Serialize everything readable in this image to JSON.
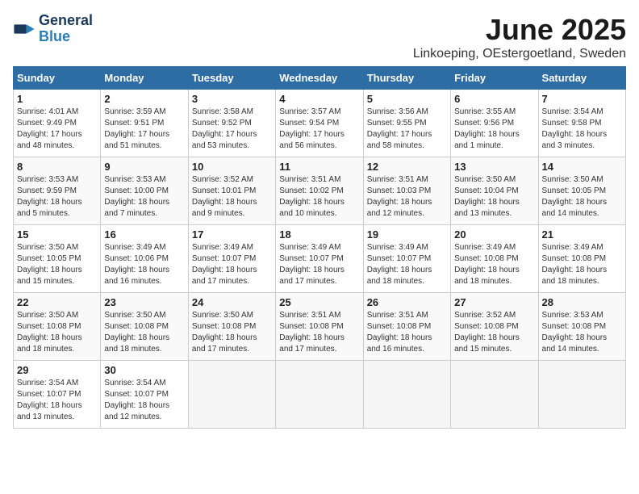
{
  "logo": {
    "line1": "General",
    "line2": "Blue"
  },
  "title": "June 2025",
  "subtitle": "Linkoeping, OEstergoetland, Sweden",
  "days_header": [
    "Sunday",
    "Monday",
    "Tuesday",
    "Wednesday",
    "Thursday",
    "Friday",
    "Saturday"
  ],
  "weeks": [
    [
      {
        "num": "1",
        "info": "Sunrise: 4:01 AM\nSunset: 9:49 PM\nDaylight: 17 hours\nand 48 minutes."
      },
      {
        "num": "2",
        "info": "Sunrise: 3:59 AM\nSunset: 9:51 PM\nDaylight: 17 hours\nand 51 minutes."
      },
      {
        "num": "3",
        "info": "Sunrise: 3:58 AM\nSunset: 9:52 PM\nDaylight: 17 hours\nand 53 minutes."
      },
      {
        "num": "4",
        "info": "Sunrise: 3:57 AM\nSunset: 9:54 PM\nDaylight: 17 hours\nand 56 minutes."
      },
      {
        "num": "5",
        "info": "Sunrise: 3:56 AM\nSunset: 9:55 PM\nDaylight: 17 hours\nand 58 minutes."
      },
      {
        "num": "6",
        "info": "Sunrise: 3:55 AM\nSunset: 9:56 PM\nDaylight: 18 hours\nand 1 minute."
      },
      {
        "num": "7",
        "info": "Sunrise: 3:54 AM\nSunset: 9:58 PM\nDaylight: 18 hours\nand 3 minutes."
      }
    ],
    [
      {
        "num": "8",
        "info": "Sunrise: 3:53 AM\nSunset: 9:59 PM\nDaylight: 18 hours\nand 5 minutes."
      },
      {
        "num": "9",
        "info": "Sunrise: 3:53 AM\nSunset: 10:00 PM\nDaylight: 18 hours\nand 7 minutes."
      },
      {
        "num": "10",
        "info": "Sunrise: 3:52 AM\nSunset: 10:01 PM\nDaylight: 18 hours\nand 9 minutes."
      },
      {
        "num": "11",
        "info": "Sunrise: 3:51 AM\nSunset: 10:02 PM\nDaylight: 18 hours\nand 10 minutes."
      },
      {
        "num": "12",
        "info": "Sunrise: 3:51 AM\nSunset: 10:03 PM\nDaylight: 18 hours\nand 12 minutes."
      },
      {
        "num": "13",
        "info": "Sunrise: 3:50 AM\nSunset: 10:04 PM\nDaylight: 18 hours\nand 13 minutes."
      },
      {
        "num": "14",
        "info": "Sunrise: 3:50 AM\nSunset: 10:05 PM\nDaylight: 18 hours\nand 14 minutes."
      }
    ],
    [
      {
        "num": "15",
        "info": "Sunrise: 3:50 AM\nSunset: 10:05 PM\nDaylight: 18 hours\nand 15 minutes."
      },
      {
        "num": "16",
        "info": "Sunrise: 3:49 AM\nSunset: 10:06 PM\nDaylight: 18 hours\nand 16 minutes."
      },
      {
        "num": "17",
        "info": "Sunrise: 3:49 AM\nSunset: 10:07 PM\nDaylight: 18 hours\nand 17 minutes."
      },
      {
        "num": "18",
        "info": "Sunrise: 3:49 AM\nSunset: 10:07 PM\nDaylight: 18 hours\nand 17 minutes."
      },
      {
        "num": "19",
        "info": "Sunrise: 3:49 AM\nSunset: 10:07 PM\nDaylight: 18 hours\nand 18 minutes."
      },
      {
        "num": "20",
        "info": "Sunrise: 3:49 AM\nSunset: 10:08 PM\nDaylight: 18 hours\nand 18 minutes."
      },
      {
        "num": "21",
        "info": "Sunrise: 3:49 AM\nSunset: 10:08 PM\nDaylight: 18 hours\nand 18 minutes."
      }
    ],
    [
      {
        "num": "22",
        "info": "Sunrise: 3:50 AM\nSunset: 10:08 PM\nDaylight: 18 hours\nand 18 minutes."
      },
      {
        "num": "23",
        "info": "Sunrise: 3:50 AM\nSunset: 10:08 PM\nDaylight: 18 hours\nand 18 minutes."
      },
      {
        "num": "24",
        "info": "Sunrise: 3:50 AM\nSunset: 10:08 PM\nDaylight: 18 hours\nand 17 minutes."
      },
      {
        "num": "25",
        "info": "Sunrise: 3:51 AM\nSunset: 10:08 PM\nDaylight: 18 hours\nand 17 minutes."
      },
      {
        "num": "26",
        "info": "Sunrise: 3:51 AM\nSunset: 10:08 PM\nDaylight: 18 hours\nand 16 minutes."
      },
      {
        "num": "27",
        "info": "Sunrise: 3:52 AM\nSunset: 10:08 PM\nDaylight: 18 hours\nand 15 minutes."
      },
      {
        "num": "28",
        "info": "Sunrise: 3:53 AM\nSunset: 10:08 PM\nDaylight: 18 hours\nand 14 minutes."
      }
    ],
    [
      {
        "num": "29",
        "info": "Sunrise: 3:54 AM\nSunset: 10:07 PM\nDaylight: 18 hours\nand 13 minutes."
      },
      {
        "num": "30",
        "info": "Sunrise: 3:54 AM\nSunset: 10:07 PM\nDaylight: 18 hours\nand 12 minutes."
      },
      null,
      null,
      null,
      null,
      null
    ]
  ]
}
